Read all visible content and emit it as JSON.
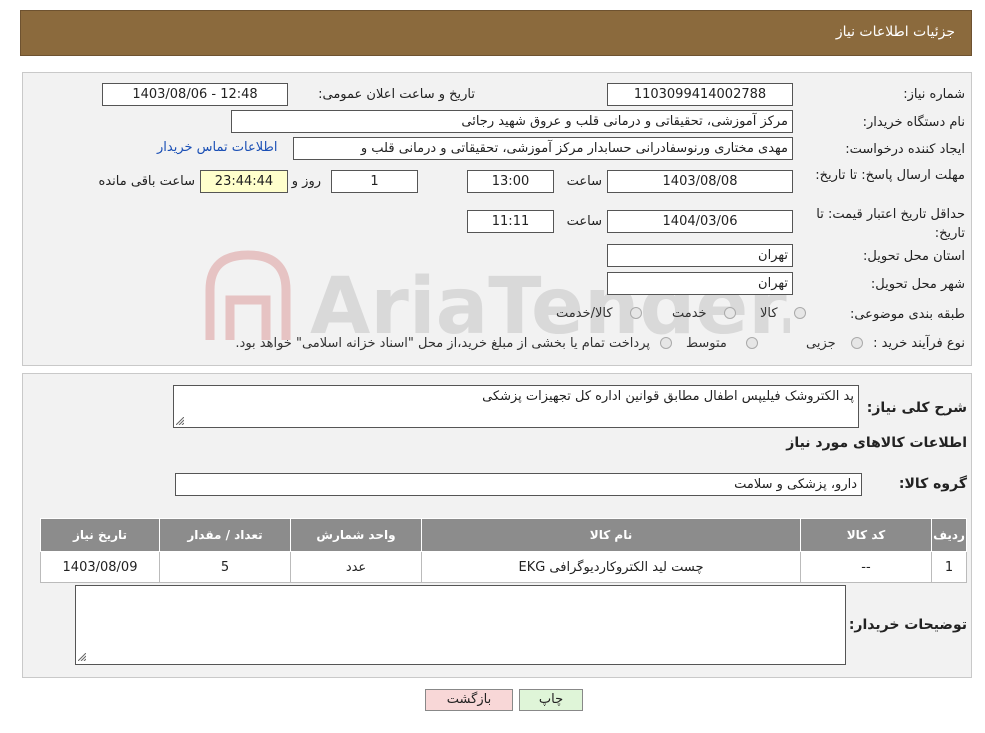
{
  "header": {
    "title": "جزئیات اطلاعات نیاز"
  },
  "form": {
    "need_number_label": "شماره نیاز:",
    "need_number": "1103099414002788",
    "announce_label": "تاریخ و ساعت اعلان عمومی:",
    "announce_value": "1403/08/06 - 12:48",
    "buyer_org_label": "نام دستگاه خریدار:",
    "buyer_org": "مرکز آموزشی، تحقیقاتی و درمانی قلب و عروق شهید رجائی",
    "creator_label": "ایجاد کننده درخواست:",
    "creator": "مهدی مختاری ورنوسفادرانی حسابدار مرکز آموزشی، تحقیقاتی و درمانی قلب و",
    "contact_link": "اطلاعات تماس خریدار",
    "deadline_label": "مهلت ارسال پاسخ: تا تاریخ:",
    "deadline_date": "1403/08/08",
    "time_word": "ساعت",
    "deadline_time": "13:00",
    "days_value": "1",
    "days_word": "روز و",
    "remaining_time": "23:44:44",
    "remaining_word": "ساعت باقی مانده",
    "validity_label": "حداقل تاریخ اعتبار قیمت: تا تاریخ:",
    "validity_date": "1404/03/06",
    "validity_time": "11:11",
    "province_label": "استان محل تحویل:",
    "province": "تهران",
    "city_label": "شهر محل تحویل:",
    "city": "تهران",
    "category_label": "طبقه بندی موضوعی:",
    "category_options": [
      "کالا",
      "خدمت",
      "کالا/خدمت"
    ],
    "process_label": "نوع فرآیند خرید :",
    "process_options": [
      "جزیی",
      "متوسط"
    ],
    "process_note": "پرداخت تمام یا بخشی از مبلغ خرید،از محل \"اسناد خزانه اسلامی\" خواهد بود."
  },
  "description": {
    "label": "شرح کلی نیاز:",
    "text": "پد الکتروشک فیلیپس اطفال مطابق قوانین اداره کل تجهیزات پزشکی"
  },
  "goods": {
    "title": "اطلاعات کالاهای مورد نیاز",
    "group_label": "گروه کالا:",
    "group_value": "دارو، پزشکی و سلامت",
    "columns": [
      "ردیف",
      "کد کالا",
      "نام کالا",
      "واحد شمارش",
      "تعداد / مقدار",
      "تاریخ نیاز"
    ],
    "rows": [
      [
        "1",
        "--",
        "چست لید الکتروکاردیوگرافی EKG",
        "عدد",
        "5",
        "1403/08/09"
      ]
    ]
  },
  "buyer_notes": {
    "label": "توضیحات خریدار:",
    "value": ""
  },
  "buttons": {
    "print": "چاپ",
    "back": "بازگشت"
  },
  "watermark": {
    "text": "AriaTender.neT"
  },
  "colors": {
    "header_bg": "#8b6a3d",
    "table_header": "#8c8c8c",
    "link": "#1a4fb5",
    "back_button": "#f8d7d7",
    "print_button": "#dff5d8"
  }
}
